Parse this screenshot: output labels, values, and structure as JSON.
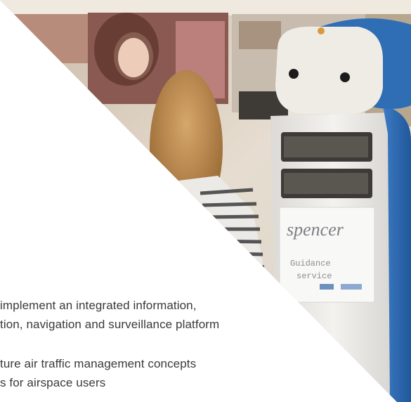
{
  "photo": {
    "subject": "robot-guide-in-shop",
    "robot_label": "spencer",
    "screen_line_1": "Guidance",
    "screen_line_2": "service"
  },
  "text_lines": [
    "implement an integrated information,",
    "tion, navigation and surveillance platform",
    "ture air traffic management concepts",
    "s for airspace users"
  ],
  "colors": {
    "robot_blue": "#2f6db5",
    "robot_white": "#eeeeea",
    "text": "#3a3a3a",
    "background": "#ffffff"
  }
}
